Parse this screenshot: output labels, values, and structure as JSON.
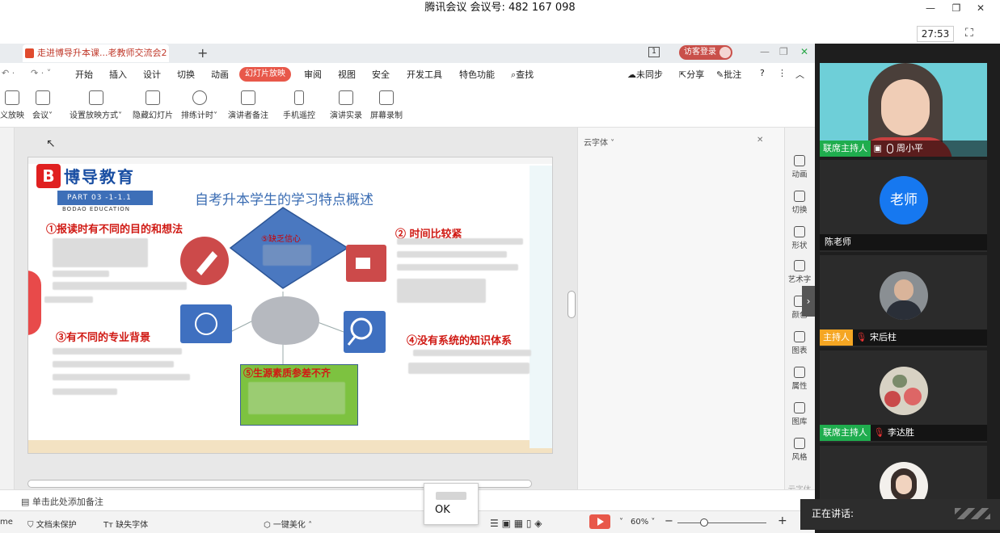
{
  "window": {
    "title": "腾讯会议 会议号: 482 167 098",
    "timer": "27:53"
  },
  "wps": {
    "doc_tab": "走进博导升本课...老教师交流会2",
    "page_badge": "1",
    "guest_login": "访客登录",
    "menu": [
      "开始",
      "插入",
      "设计",
      "切换",
      "动画",
      "幻灯片放映",
      "审阅",
      "视图",
      "安全",
      "开发工具",
      "特色功能",
      "查找"
    ],
    "active_menu": "幻灯片放映",
    "right_menu": [
      "未同步",
      "分享",
      "批注"
    ],
    "ribbon": [
      "义放映",
      "会议",
      "设置放映方式",
      "隐藏幻灯片",
      "排练计时",
      "演讲者备注",
      "手机遥控",
      "演讲实录",
      "屏幕录制"
    ],
    "right_pane_title": "云字体",
    "sidebar": [
      "动画",
      "切换",
      "形状",
      "艺术字",
      "颜色",
      "图表",
      "属性",
      "图库",
      "风格",
      "云字体"
    ],
    "notes_placeholder": "单击此处添加备注",
    "status": {
      "left": "me",
      "doc_protect": "文档未保护",
      "missing_font": "缺失字体",
      "beautify": "一键美化",
      "zoom": "60%"
    },
    "popup_ok": "OK"
  },
  "slide": {
    "logo_text": "博导教育",
    "part": "PART 03 -1-1.1",
    "logo_en": "BODAO EDUCATION",
    "title": "自考升本学生的学习特点概述",
    "p1": "①报读时有不同的目的和想法",
    "p2": "② 时间比较紧",
    "p3": "③有不同的专业背景",
    "p4": "④没有系统的知识体系",
    "p5": "⑤生源素质参差不齐",
    "diamond": "⑤缺乏信心"
  },
  "participants": [
    {
      "role": "联席主持人",
      "name": "周小平",
      "type": "video"
    },
    {
      "role": "",
      "name": "陈老师",
      "type": "avatar",
      "avatar_text": "老师"
    },
    {
      "role": "主持人",
      "name": "宋后柱",
      "type": "photo"
    },
    {
      "role": "联席主持人",
      "name": "李达胜",
      "type": "photo"
    },
    {
      "role": "",
      "name": "",
      "type": "photo"
    }
  ],
  "speaking_label": "正在讲话:",
  "colors": {
    "accent_red": "#e8584a",
    "cohost_green": "#1fad4e",
    "host_orange": "#f5a623",
    "avatar_blue": "#1678f0"
  }
}
